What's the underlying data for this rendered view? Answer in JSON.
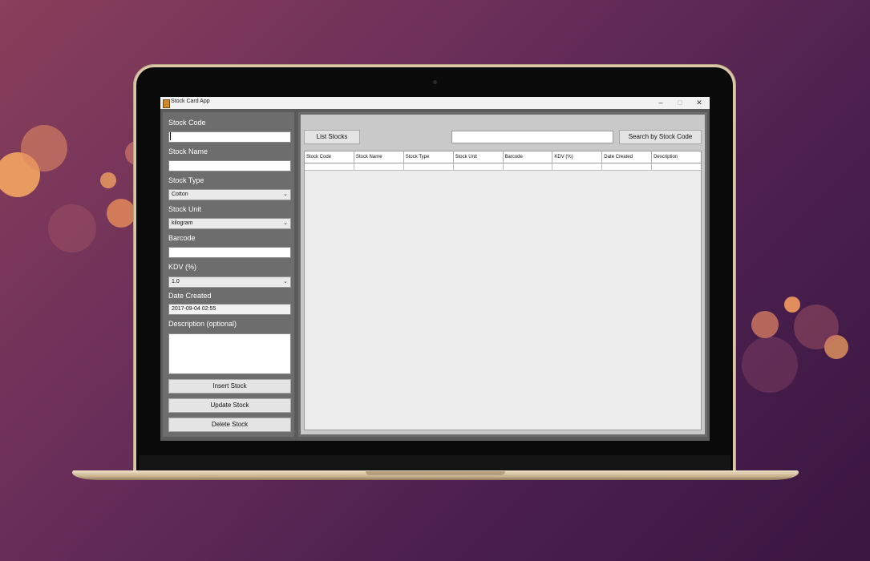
{
  "window": {
    "title": "Stock Card App",
    "minimize": "–",
    "maximize": "□",
    "close": "✕"
  },
  "form": {
    "stock_code_label": "Stock Code",
    "stock_code_value": "",
    "stock_name_label": "Stock Name",
    "stock_name_value": "",
    "stock_type_label": "Stock Type",
    "stock_type_value": "Cotton",
    "stock_unit_label": "Stock Unit",
    "stock_unit_value": "kilogram",
    "barcode_label": "Barcode",
    "barcode_value": "",
    "kdv_label": "KDV (%)",
    "kdv_value": "1.0",
    "date_created_label": "Date Created",
    "date_created_value": "2017-09-04 02:55",
    "description_label": "Description (optional)",
    "description_value": "",
    "insert_label": "Insert Stock",
    "update_label": "Update Stock",
    "delete_label": "Delete Stock"
  },
  "toolbar": {
    "list_label": "List Stocks",
    "search_value": "",
    "search_button_label": "Search by Stock Code"
  },
  "table": {
    "columns": [
      "Stock Code",
      "Stock Name",
      "Stock Type",
      "Stock Unit",
      "Barcode",
      "KDV (%)",
      "Date Created",
      "Description"
    ],
    "rows": []
  },
  "icons": {
    "chevron": "chevron-down-icon",
    "app_icon": "java-app-icon"
  },
  "colors": {
    "panel": "#6d6d6d",
    "content": "#c9c9c9",
    "background": "#6b2f5a"
  }
}
